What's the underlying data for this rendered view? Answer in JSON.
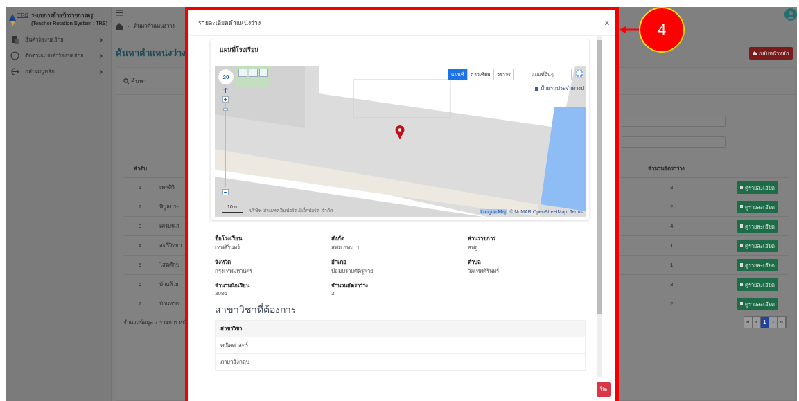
{
  "sidebar": {
    "logo_text": "TRS",
    "system_name": "ระบบการย้ายข้าราชการครู",
    "system_subtitle": "(Teacher Rotation System : TRS)",
    "items": [
      {
        "label": "ยื่นคำร้องขอย้าย",
        "kind": "document"
      },
      {
        "label": "ติดตามแบบคำร้องขอย้าย",
        "kind": "search"
      },
      {
        "label": "กลับเมนูหลัก",
        "kind": "exit"
      }
    ]
  },
  "header": {
    "breadcrumb": "ค้นหาตำแหน่งว่าง",
    "page_title": "ค้นหาตำแหน่งว่าง",
    "back_button": "กลับหน้าหลัก"
  },
  "search_card": {
    "title": "ค้นหา"
  },
  "table": {
    "columns": [
      "ลำดับ",
      "จำนวนอัตราว่าง"
    ],
    "rows": [
      {
        "no": "1",
        "school": "เทพศิริ",
        "vacancies": "3",
        "action": "ดูรายละเอียด"
      },
      {
        "no": "2",
        "school": "พิบูลประ",
        "vacancies": "2",
        "action": "ดูรายละเอียด"
      },
      {
        "no": "3",
        "school": "เศรษฐเส",
        "vacancies": "4",
        "action": "ดูรายละเอียด"
      },
      {
        "no": "4",
        "school": "สตรีวิทยา",
        "vacancies": "1",
        "action": "ดูรายละเอียด"
      },
      {
        "no": "5",
        "school": "โสตศึกษ",
        "vacancies": "1",
        "action": "ดูรายละเอียด"
      },
      {
        "no": "6",
        "school": "บ้านห้วย",
        "vacancies": "3",
        "action": "ดูรายละเอียด"
      },
      {
        "no": "7",
        "school": "บ้านหาด",
        "vacancies": "2",
        "action": "ดูรายละเอียด"
      }
    ]
  },
  "footer": {
    "summary": "จำนวนข้อมูล 7 รายการ หน้",
    "pagination": [
      {
        "label": "«",
        "selected": false
      },
      {
        "label": "‹",
        "selected": false
      },
      {
        "label": "1",
        "selected": true
      },
      {
        "label": "›",
        "selected": false
      },
      {
        "label": "»",
        "selected": false
      }
    ]
  },
  "modal": {
    "title": "รายละเอียดตำแหน่งว่าง",
    "close": "×",
    "map": {
      "title": "แผนที่โรงเรียน",
      "zoom": "20",
      "zoom_slider": {
        "level": 0.95
      },
      "type_tabs": [
        {
          "label": "แผนที่",
          "selected": true
        },
        {
          "label": "ดาวเทียม",
          "selected": false
        },
        {
          "label": "จราจร",
          "selected": false
        }
      ],
      "other_maps": "แผนที่อื่นๆ",
      "place_label": "ป้ายรถประจำทางป",
      "scale": "10 m",
      "owner": "บริษัท สายเทคอิมปอร์ต&เอ็กปอร์ต จำกัด",
      "brand": "Longdo Map",
      "attribution": "© NuMAR OpenStreetMap, Terms"
    },
    "fields": [
      {
        "label": "ชื่อโรงเรียน",
        "value": "เทพศิรินทร์"
      },
      {
        "label": "สังกัด",
        "value": "สพม.กทม. 1"
      },
      {
        "label": "ส่วนราชการ",
        "value": "สพฐ."
      },
      {
        "label": "จังหวัด",
        "value": "กรุงเทพมหานคร"
      },
      {
        "label": "อำเภอ",
        "value": "ป้อมปราบศัตรูพ่าย"
      },
      {
        "label": "ตำบล",
        "value": "วัดเทพศิรินทร์"
      },
      {
        "label": "จำนวนนักเรียน",
        "value": "3086"
      },
      {
        "label": "จำนวนอัตราว่าง",
        "value": "3"
      }
    ],
    "subjects_title": "สาขาวิชาที่ต้องการ",
    "subjects_column": "สาขาวิชา",
    "subjects": [
      "คณิตศาสตร์",
      "ภาษาอังกฤษ"
    ],
    "close_button": "ปิด"
  },
  "annotation": {
    "number": "4"
  }
}
